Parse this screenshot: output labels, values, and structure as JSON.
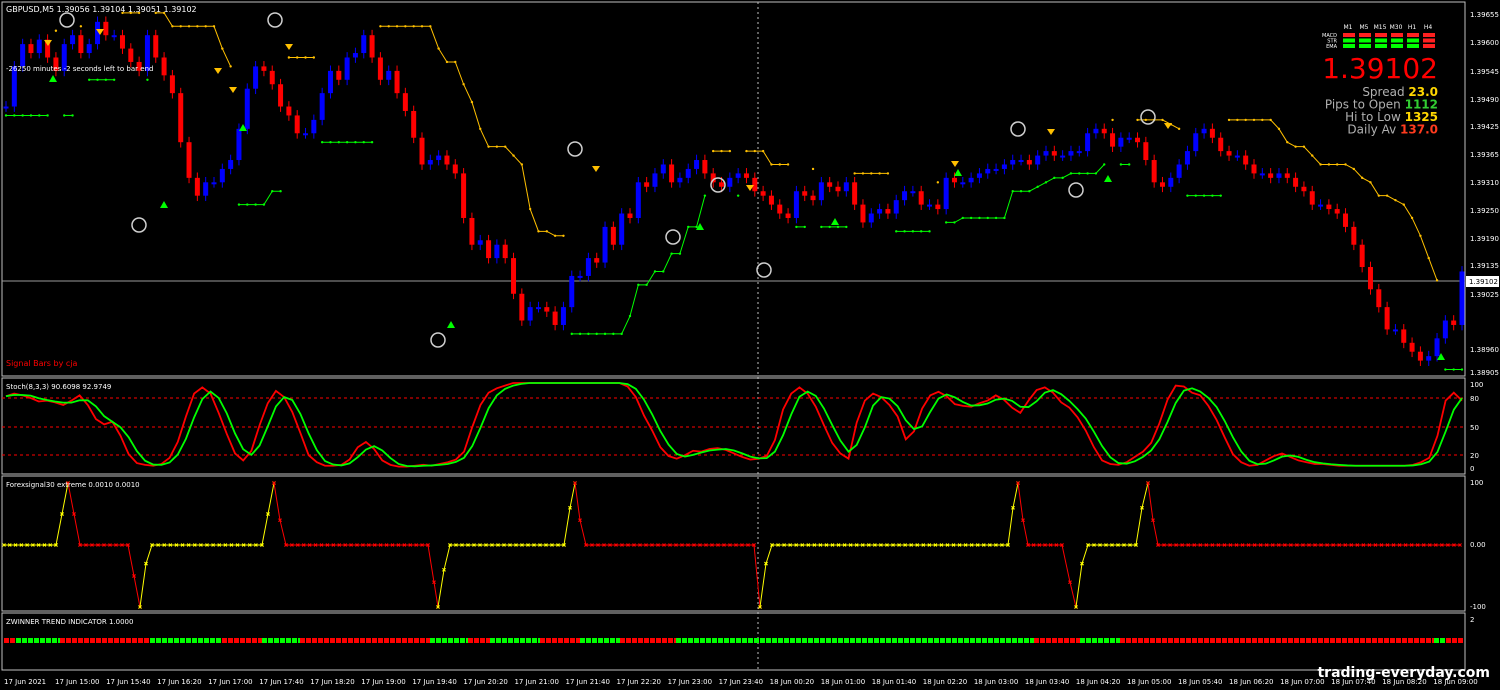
{
  "main": {
    "header": "GBPUSD,M5  1.39056 1.39104 1.39051 1.39102",
    "timer": "-26250 minutes -2 seconds left to bar end",
    "signal_label": "Signal Bars by cja",
    "price_axis": [
      "1.39655",
      "1.39600",
      "1.39545",
      "1.39490",
      "1.39425",
      "1.39365",
      "1.39310",
      "1.39250",
      "1.39190",
      "1.39135",
      "1.39025",
      "1.38960",
      "1.38905"
    ],
    "current_price": "1.39102"
  },
  "dashboard": {
    "timeframes": [
      "M1",
      "M5",
      "M15",
      "M30",
      "H1",
      "H4"
    ],
    "rows": [
      {
        "name": "MACD",
        "cells": [
          "red",
          "red",
          "red",
          "red",
          "red",
          "red"
        ]
      },
      {
        "name": "STR",
        "cells": [
          "green",
          "green",
          "green",
          "green",
          "green",
          "red"
        ]
      },
      {
        "name": "EMA",
        "cells": [
          "green",
          "green",
          "green",
          "green",
          "green",
          "red"
        ]
      }
    ],
    "price": "1.39102",
    "stats": [
      {
        "label": "Spread",
        "value": "23.0",
        "color": "#ffd700"
      },
      {
        "label": "Pips to Open",
        "value": "1112",
        "color": "#32cd32"
      },
      {
        "label": "Hi to Low",
        "value": "1325",
        "color": "#ffd700"
      },
      {
        "label": "Daily Av",
        "value": "137.0",
        "color": "#ff3b1e"
      }
    ]
  },
  "stoch": {
    "header": "Stoch(8,3,3) 90.6098 92.9749",
    "axis": [
      "100",
      "80",
      "50",
      "20",
      "0"
    ]
  },
  "forex": {
    "header": "Forexsignal30 extreme 0.0010 0.0010",
    "axis": [
      "100",
      "0.00",
      "-100"
    ]
  },
  "zwinner": {
    "header": "ZWINNER TREND INDICATOR 1.0000",
    "axis": [
      "2"
    ]
  },
  "time_axis": [
    "17 Jun 2021",
    "17 Jun 15:00",
    "17 Jun 15:40",
    "17 Jun 16:20",
    "17 Jun 17:00",
    "17 Jun 17:40",
    "17 Jun 18:20",
    "17 Jun 19:00",
    "17 Jun 19:40",
    "17 Jun 20:20",
    "17 Jun 21:00",
    "17 Jun 21:40",
    "17 Jun 22:20",
    "17 Jun 23:00",
    "17 Jun 23:40",
    "18 Jun 00:20",
    "18 Jun 01:00",
    "18 Jun 01:40",
    "18 Jun 02:20",
    "18 Jun 03:00",
    "18 Jun 03:40",
    "18 Jun 04:20",
    "18 Jun 05:00",
    "18 Jun 05:40",
    "18 Jun 06:20",
    "18 Jun 07:00",
    "18 Jun 07:40",
    "18 Jun 08:20",
    "18 Jun 09:00"
  ],
  "watermark": "trading-everyday.com",
  "colors": {
    "bull": "#0000ff",
    "bear": "#ff0000",
    "trail_down": "#ffc000",
    "trail_up": "#00ff00",
    "stoch_main": "#ff0000",
    "stoch_signal": "#00ff00",
    "forex_yellow": "#ffff00",
    "forex_red": "#ff0000"
  },
  "price_series": [
    1.3947,
    1.3956,
    1.3961,
    1.3959,
    1.3962,
    1.3958,
    1.3955,
    1.3961,
    1.3963,
    1.3959,
    1.3961,
    1.3966,
    1.3963,
    1.3963,
    1.396,
    1.3957,
    1.3955,
    1.3963,
    1.3958,
    1.3954,
    1.395,
    1.3939,
    1.3931,
    1.3927,
    1.393,
    1.393,
    1.3933,
    1.3935,
    1.3942,
    1.3951,
    1.3956,
    1.3955,
    1.3952,
    1.3947,
    1.3945,
    1.3941,
    1.3941,
    1.3944,
    1.395,
    1.3955,
    1.3953,
    1.3958,
    1.3959,
    1.3963,
    1.3958,
    1.3953,
    1.3955,
    1.395,
    1.3946,
    1.394,
    1.3934,
    1.3935,
    1.3936,
    1.3934,
    1.3932,
    1.3922,
    1.3916,
    1.3917,
    1.3913,
    1.3916,
    1.3913,
    1.3905,
    1.3899,
    1.3902,
    1.3902,
    1.3901,
    1.3898,
    1.3902,
    1.3909,
    1.3909,
    1.3913,
    1.3912,
    1.392,
    1.3916,
    1.3923,
    1.3922,
    1.393,
    1.3929,
    1.3932,
    1.3934,
    1.393,
    1.3931,
    1.3933,
    1.3935,
    1.3932,
    1.393,
    1.3929,
    1.3931,
    1.3932,
    1.3931,
    1.3928,
    1.3927,
    1.3925,
    1.3923,
    1.3922,
    1.3928,
    1.3927,
    1.3926,
    1.393,
    1.3929,
    1.3928,
    1.393,
    1.3925,
    1.3921,
    1.3923,
    1.3924,
    1.3923,
    1.3926,
    1.3928,
    1.3928,
    1.3925,
    1.3925,
    1.3924,
    1.3931,
    1.393,
    1.393,
    1.3931,
    1.3932,
    1.3933,
    1.3933,
    1.3934,
    1.3935,
    1.3935,
    1.3934,
    1.3936,
    1.3937,
    1.3936,
    1.3936,
    1.3937,
    1.3937,
    1.3941,
    1.3942,
    1.3941,
    1.3938,
    1.394,
    1.394,
    1.3939,
    1.3935,
    1.393,
    1.3929,
    1.3931,
    1.3934,
    1.3937,
    1.3941,
    1.3942,
    1.394,
    1.3937,
    1.3936,
    1.3936,
    1.3934,
    1.3932,
    1.3932,
    1.3931,
    1.3932,
    1.3931,
    1.3929,
    1.3928,
    1.3925,
    1.3925,
    1.3924,
    1.3923,
    1.392,
    1.3916,
    1.3911,
    1.3906,
    1.3902,
    1.3897,
    1.3897,
    1.3894,
    1.3892,
    1.389,
    1.3891,
    1.3895,
    1.3899,
    1.3898,
    1.391
  ],
  "stoch_series": [
    85,
    88,
    86,
    83,
    79,
    80,
    78,
    75,
    80,
    86,
    75,
    59,
    53,
    56,
    40,
    19,
    9,
    7,
    6,
    8,
    15,
    33,
    62,
    88,
    95,
    88,
    66,
    42,
    20,
    12,
    23,
    52,
    77,
    91,
    84,
    67,
    43,
    18,
    10,
    6,
    6,
    7,
    13,
    27,
    33,
    25,
    12,
    7,
    5,
    5,
    6,
    7,
    6,
    8,
    10,
    13,
    22,
    50,
    75,
    89,
    94,
    97,
    100,
    100,
    100,
    100,
    100,
    100,
    100,
    100,
    100,
    100,
    100,
    100,
    100,
    100,
    96,
    84,
    63,
    46,
    27,
    17,
    14,
    18,
    23,
    22,
    25,
    26,
    24,
    20,
    16,
    13,
    14,
    17,
    35,
    70,
    88,
    95,
    88,
    73,
    52,
    32,
    20,
    14,
    55,
    80,
    88,
    84,
    75,
    62,
    36,
    45,
    71,
    86,
    90,
    85,
    76,
    74,
    73,
    77,
    80,
    86,
    81,
    72,
    66,
    80,
    92,
    95,
    89,
    78,
    72,
    61,
    46,
    27,
    12,
    8,
    7,
    10,
    16,
    22,
    32,
    54,
    81,
    97,
    96,
    89,
    86,
    74,
    58,
    38,
    19,
    10,
    6,
    7,
    12,
    17,
    20,
    16,
    12,
    10,
    8,
    8,
    7,
    6,
    6,
    6,
    6,
    6,
    6,
    6,
    6,
    6,
    7,
    10,
    15,
    40,
    80,
    89,
    80
  ]
}
